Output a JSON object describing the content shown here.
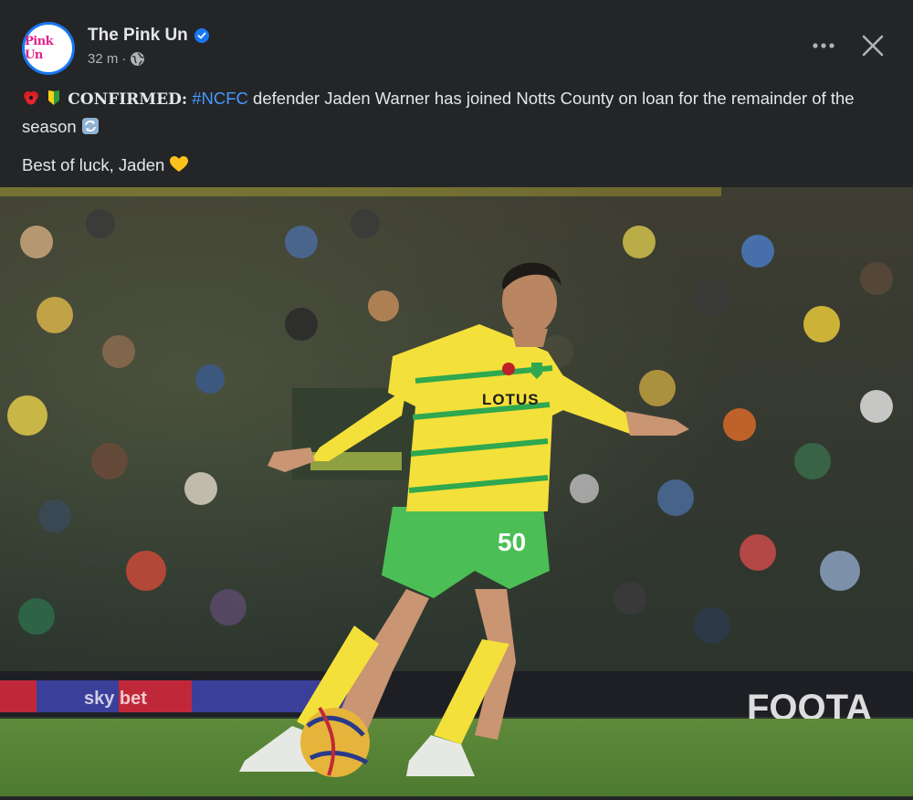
{
  "post": {
    "page_name": "The Pink Un",
    "avatar_text": "Pink Un",
    "timestamp": "32 m",
    "audience_icon": "globe-icon",
    "verified_icon": "verified-badge-icon",
    "more_icon": "more-dots-icon",
    "close_icon": "close-icon",
    "text_line1": {
      "emoji_1": "poppy-emoji",
      "emoji_2": "beginner-symbol-emoji",
      "confirmed": "CONFIRMED",
      "colon": ":",
      "hashtag": "#NCFC",
      "body": " defender Jaden Warner has joined Notts County on loan for the remainder of the season ",
      "emoji_3": "repeat-emoji"
    },
    "text_line2": {
      "body": "Best of luck, Jaden ",
      "emoji": "yellow-heart-emoji"
    },
    "photo": {
      "shirt_sponsor": "LOTUS",
      "shirt_number": "50",
      "board_text": "FOOTA",
      "board_brand": "sky bet"
    }
  },
  "colors": {
    "background": "#242526",
    "text": "#e4e6eb",
    "secondary_text": "#b0b3b8",
    "link": "#4599ff",
    "verified": "#1877f2",
    "kit_yellow": "#f2e34a",
    "kit_green": "#2fa84f"
  }
}
